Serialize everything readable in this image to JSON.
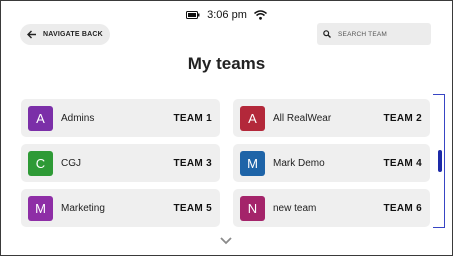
{
  "status_bar": {
    "time": "3:06 pm",
    "icons": [
      "battery-icon",
      "wifi-icon"
    ]
  },
  "header": {
    "back_label": "NAVIGATE BACK",
    "search_placeholder": "SEARCH TEAM",
    "title": "My teams"
  },
  "teams": [
    {
      "initial": "A",
      "name": "Admins",
      "team": "TEAM 1",
      "color": "#7b2fa8"
    },
    {
      "initial": "A",
      "name": "All RealWear",
      "team": "TEAM 2",
      "color": "#b3283a"
    },
    {
      "initial": "C",
      "name": "CGJ",
      "team": "TEAM 3",
      "color": "#2e9a36"
    },
    {
      "initial": "M",
      "name": "Mark Demo",
      "team": "TEAM 4",
      "color": "#1e64a8"
    },
    {
      "initial": "M",
      "name": "Marketing",
      "team": "TEAM 5",
      "color": "#8e2ea6"
    },
    {
      "initial": "N",
      "name": "new team",
      "team": "TEAM 6",
      "color": "#a4246a"
    }
  ],
  "colors": {
    "accent": "#1d2aa8",
    "card_bg": "#efefef"
  }
}
